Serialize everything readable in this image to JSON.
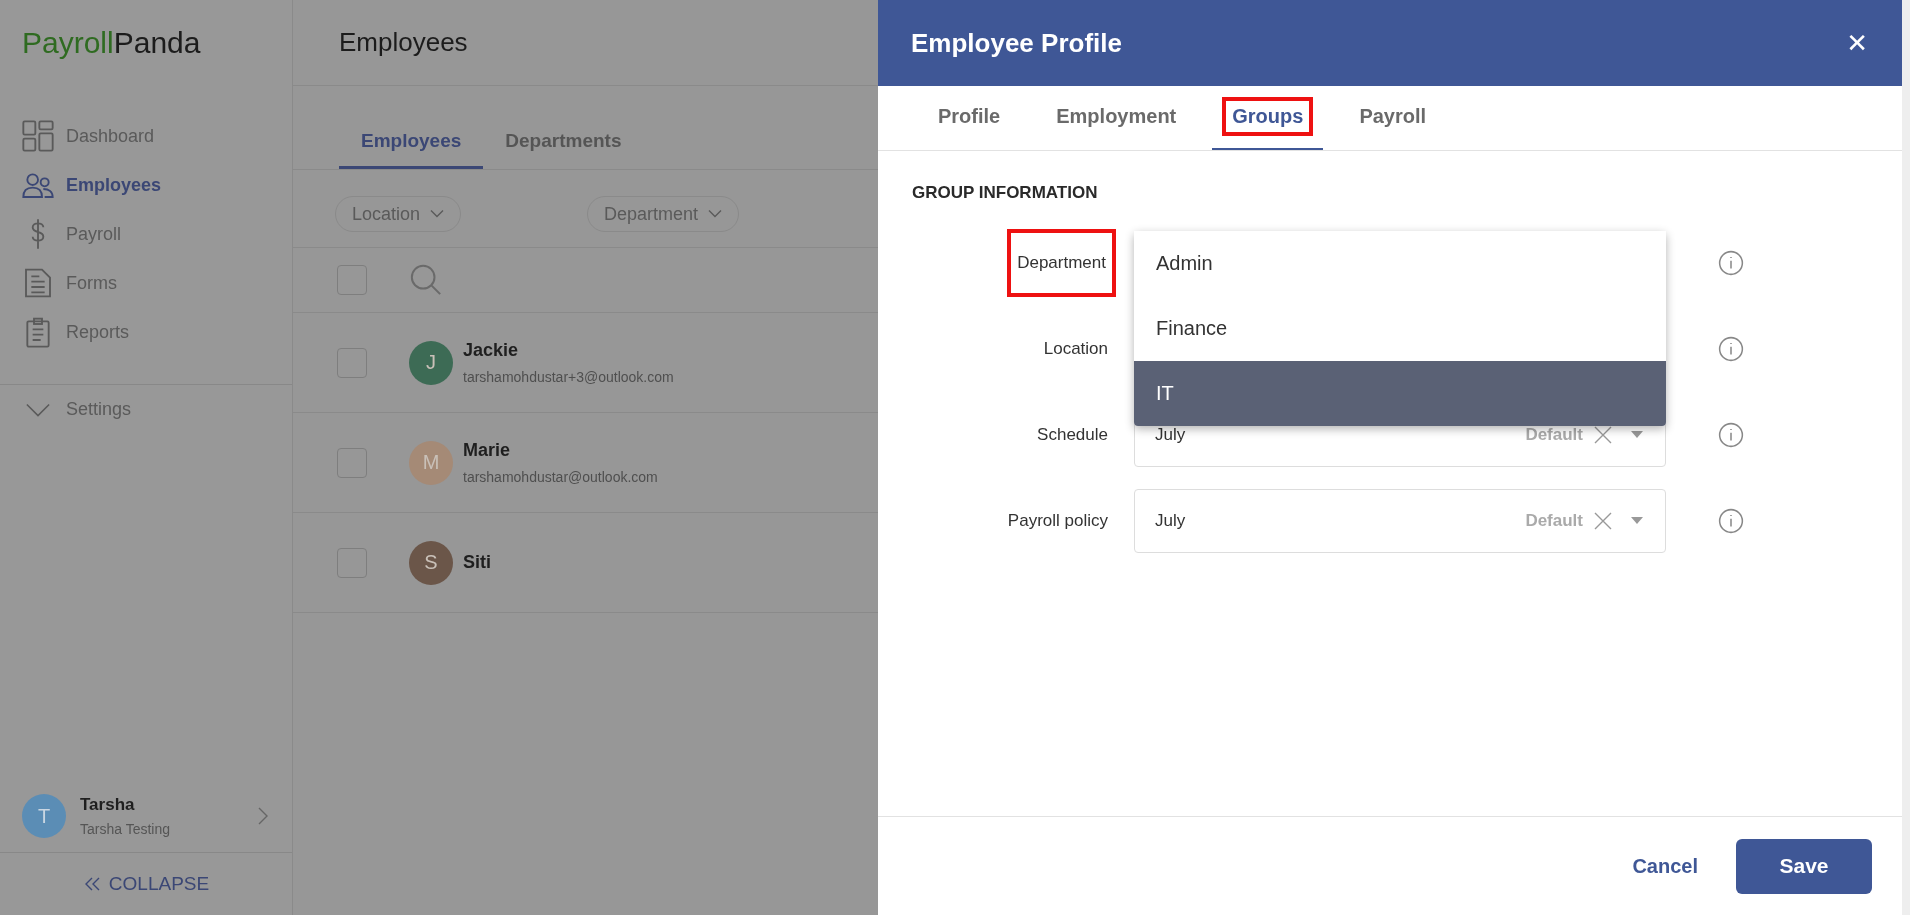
{
  "sidebar": {
    "logo": {
      "accent": "Payroll",
      "rest": "Panda"
    },
    "items": [
      {
        "label": "Dashboard",
        "selected": false
      },
      {
        "label": "Employees",
        "selected": true
      },
      {
        "label": "Payroll",
        "selected": false
      },
      {
        "label": "Forms",
        "selected": false
      },
      {
        "label": "Reports",
        "selected": false
      }
    ],
    "settings": {
      "label": "Settings"
    },
    "user": {
      "initial": "T",
      "name": "Tarsha",
      "subtitle": "Tarsha Testing",
      "color": "#5b8db5"
    },
    "collapse": "COLLAPSE"
  },
  "main": {
    "title": "Employees",
    "tabs": [
      {
        "label": "Employees",
        "selected": true
      },
      {
        "label": "Departments",
        "selected": false
      }
    ],
    "filters": [
      "Location",
      "Department"
    ],
    "select_all": {
      "checked": false
    },
    "rows": [
      {
        "initial": "J",
        "name": "Jackie",
        "email": "tarshamohdustar+3@outlook.com",
        "color": "#3d6b55",
        "checked": false
      },
      {
        "initial": "M",
        "name": "Marie",
        "email": "tarshamohdustar@outlook.com",
        "color": "#a58a76",
        "checked": false
      },
      {
        "initial": "S",
        "name": "Siti",
        "color": "#6b5649",
        "checked": false
      }
    ]
  },
  "panel": {
    "title": "Employee Profile",
    "close": "✕",
    "tabs": [
      {
        "label": "Profile",
        "selected": false,
        "highlighted": false
      },
      {
        "label": "Employment",
        "selected": false,
        "highlighted": false
      },
      {
        "label": "Groups",
        "selected": true,
        "highlighted": true
      },
      {
        "label": "Payroll",
        "selected": false,
        "highlighted": false
      }
    ],
    "section": "GROUP INFORMATION",
    "fields": [
      {
        "label": "Department",
        "highlighted": true,
        "options": [
          {
            "label": "Admin",
            "selected": false
          },
          {
            "label": "Finance",
            "selected": false
          },
          {
            "label": "IT",
            "selected": true
          }
        ]
      },
      {
        "label": "Location",
        "highlighted": false
      },
      {
        "label": "Schedule",
        "highlighted": false,
        "value": "July",
        "badge": "Default"
      },
      {
        "label": "Payroll policy",
        "highlighted": false,
        "value": "July",
        "badge": "Default"
      }
    ],
    "buttons": {
      "cancel": "Cancel",
      "save": "Save"
    }
  }
}
